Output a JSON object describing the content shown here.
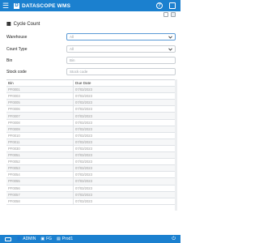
{
  "app": {
    "title": "DATASCOPE WMS",
    "logo_char": "D"
  },
  "header_icons": {
    "help": "?",
    "grid": "⊞"
  },
  "page": {
    "title": "Cycle Count"
  },
  "form": {
    "warehouse": {
      "label": "Warehouse",
      "value": "All"
    },
    "count_type": {
      "label": "Count Type",
      "value": "All"
    },
    "bin": {
      "label": "Bin",
      "placeholder": "Bin"
    },
    "stock_code": {
      "label": "Stock code",
      "placeholder": "Stock code"
    }
  },
  "table": {
    "headers": [
      "Bin",
      "Due Date"
    ],
    "rows": [
      [
        "PF0001",
        "07/03/2023"
      ],
      [
        "PF0003",
        "07/03/2023"
      ],
      [
        "PF0005",
        "07/03/2023"
      ],
      [
        "PF0006",
        "07/03/2023"
      ],
      [
        "PF0007",
        "07/03/2023"
      ],
      [
        "PF0008",
        "07/03/2023"
      ],
      [
        "PF0009",
        "07/03/2023"
      ],
      [
        "PF0010",
        "07/03/2023"
      ],
      [
        "PF0011",
        "07/03/2023"
      ],
      [
        "PF0030",
        "07/03/2023"
      ],
      [
        "PF0051",
        "07/03/2023"
      ],
      [
        "PF0052",
        "07/03/2023"
      ],
      [
        "PF0053",
        "07/03/2023"
      ],
      [
        "PF0054",
        "07/03/2023"
      ],
      [
        "PF0055",
        "07/03/2023"
      ],
      [
        "PF0056",
        "07/03/2023"
      ],
      [
        "PF0057",
        "07/03/2023"
      ],
      [
        "PF0058",
        "07/03/2023"
      ]
    ]
  },
  "footer": {
    "user": "ADMIN",
    "warehouse": "FG",
    "printer": "Prod1"
  },
  "colors": {
    "brand": "#1b80cf"
  }
}
